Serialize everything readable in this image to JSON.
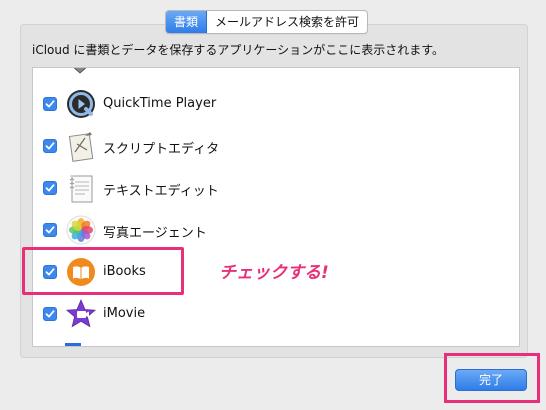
{
  "tabs": [
    {
      "label": "書類",
      "active": true
    },
    {
      "label": "メールアドレス検索を許可",
      "active": false
    }
  ],
  "description": "iCloud に書類とデータを保存するアプリケーションがここに表示されます。",
  "apps": [
    {
      "name": "QuickTime Player",
      "checked": true,
      "icon": "quicktime-icon"
    },
    {
      "name": "スクリプトエディタ",
      "checked": true,
      "icon": "script-editor-icon"
    },
    {
      "name": "テキストエディット",
      "checked": true,
      "icon": "textedit-icon"
    },
    {
      "name": "写真エージェント",
      "checked": true,
      "icon": "photos-icon"
    },
    {
      "name": "iBooks",
      "checked": true,
      "icon": "ibooks-icon"
    },
    {
      "name": "iMovie",
      "checked": true,
      "icon": "imovie-icon"
    }
  ],
  "annotation": "チェックする!",
  "done_label": "完了",
  "colors": {
    "accent": "#3a88f0",
    "highlight": "#e8307a"
  }
}
